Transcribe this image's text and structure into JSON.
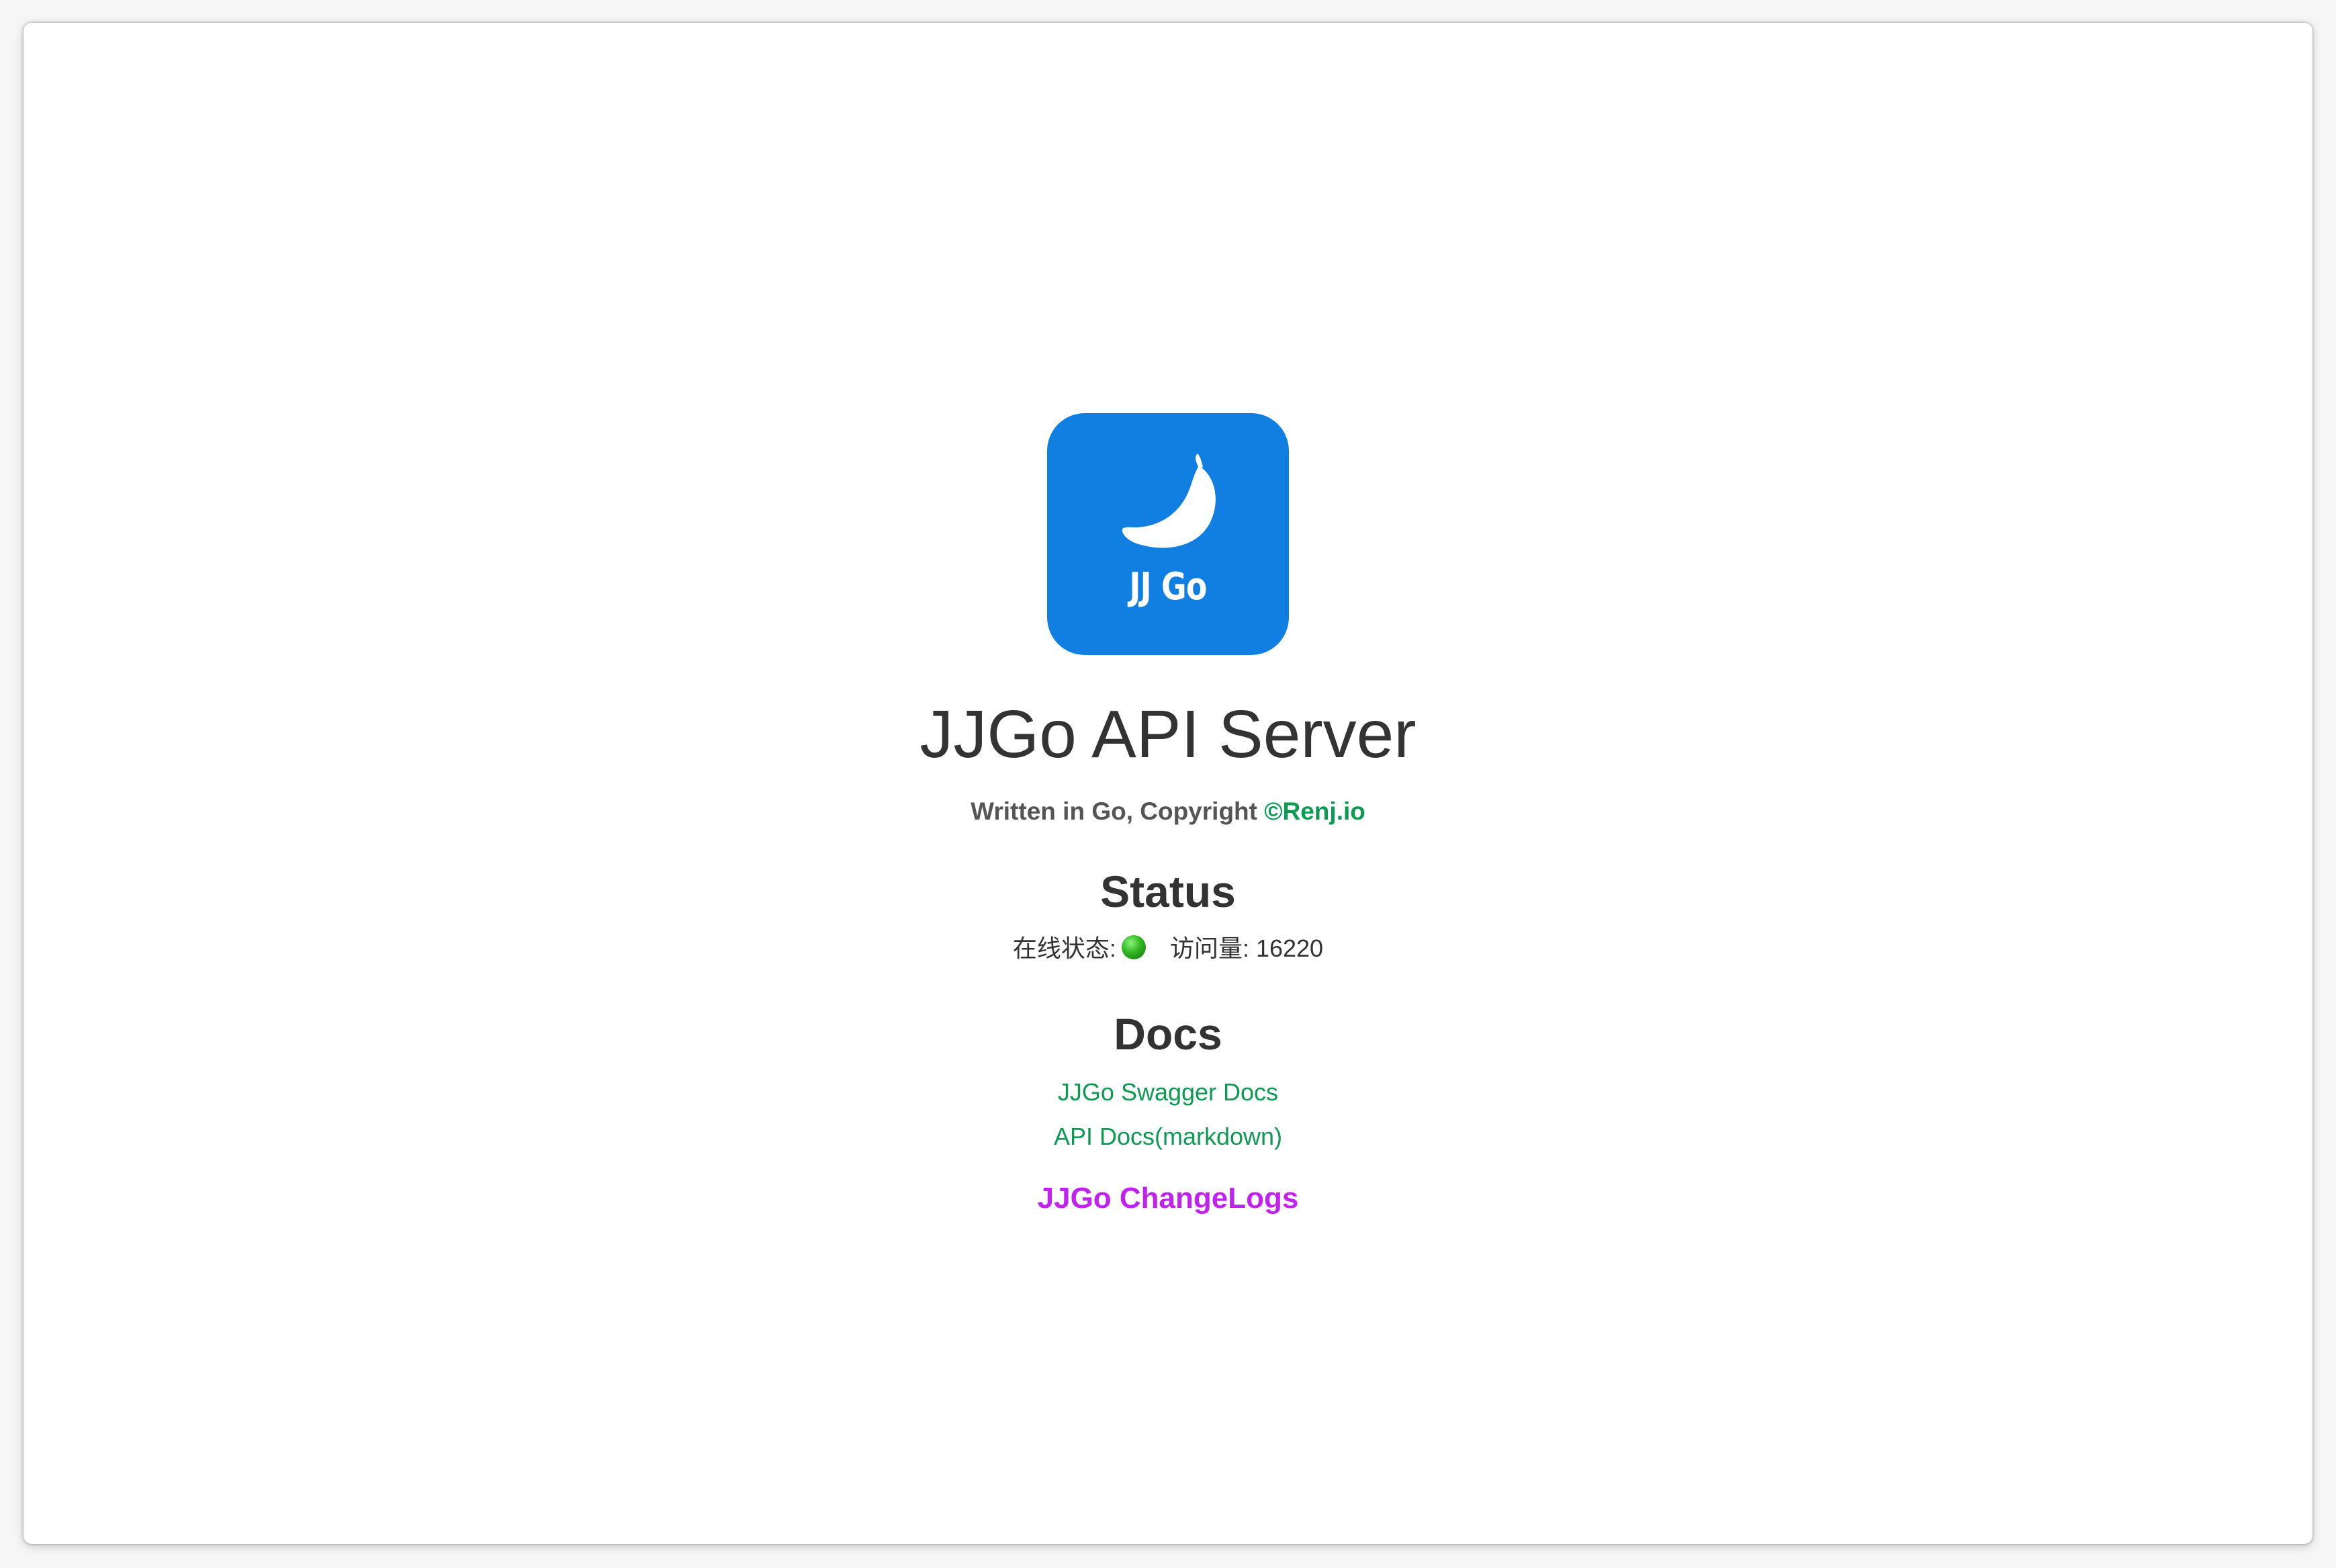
{
  "logo": {
    "text": "JJ Go",
    "background_color": "#117fe2",
    "icon": "chili-pepper-icon"
  },
  "header": {
    "title": "JJGo API Server",
    "subtitle_prefix": "Written in Go, Copyright ",
    "copyright_link": "©Renj.io"
  },
  "status": {
    "heading": "Status",
    "online_label": "在线状态:",
    "online_indicator_color": "#2fb51f",
    "visits_label": "访问量:",
    "visits_value": "16220"
  },
  "docs": {
    "heading": "Docs",
    "links": [
      "JJGo Swagger Docs",
      "API Docs(markdown)"
    ],
    "link_color": "#0d9a52"
  },
  "changelog": {
    "label": "JJGo ChangeLogs",
    "color": "#c023ee"
  }
}
